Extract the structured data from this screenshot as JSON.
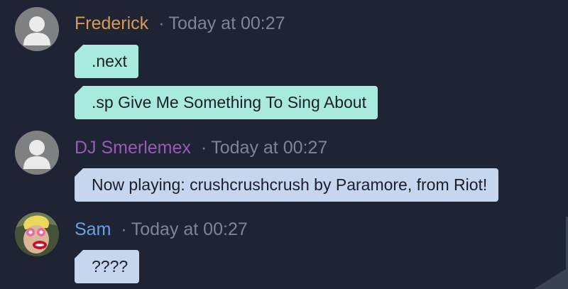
{
  "colors": {
    "background": "#1e2433",
    "bubble_user": "#a8eadd",
    "bubble_bot": "#c6d6ee",
    "name_frederick": "#d99b52",
    "name_dj": "#9b59b6",
    "name_sam": "#6c9ee8",
    "timestamp": "#7e8597"
  },
  "messages": [
    {
      "author": "Frederick",
      "separator": "·",
      "time": "Today at 00:27",
      "avatar_icon": "default-user-avatar-icon",
      "lines": [
        ".next",
        ".sp Give Me Something To Sing About"
      ]
    },
    {
      "author": "DJ Smerlemex",
      "separator": "·",
      "time": "Today at 00:27",
      "avatar_icon": "default-user-avatar-icon",
      "lines": [
        "Now playing: crushcrushcrush by Paramore, from Riot!"
      ]
    },
    {
      "author": "Sam",
      "separator": "·",
      "time": "Today at 00:27",
      "avatar_icon": "cartoon-character-avatar-icon",
      "lines": [
        "????"
      ]
    }
  ]
}
